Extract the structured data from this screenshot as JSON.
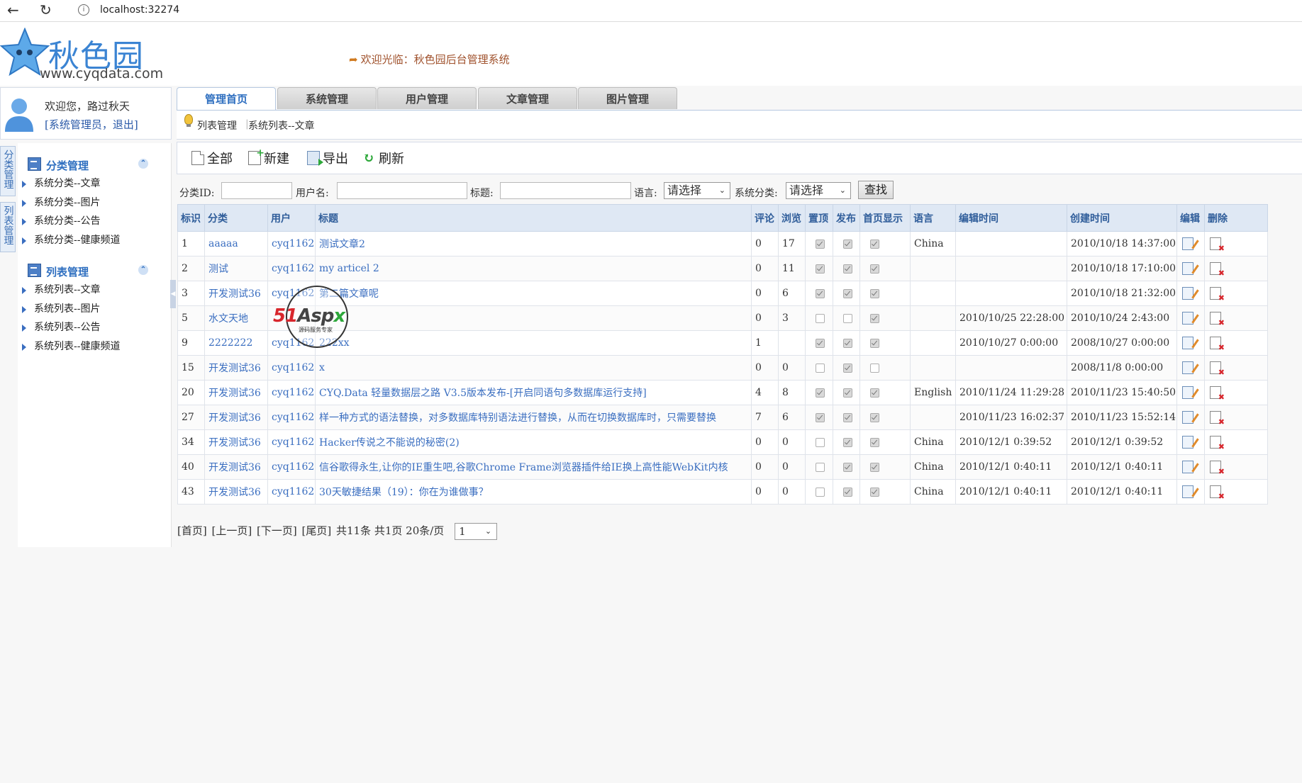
{
  "browser": {
    "url": "localhost:32274"
  },
  "header": {
    "logo_title": "秋色园",
    "logo_url": "www.cyqdata.com",
    "welcome_banner": "欢迎光临：秋色园后台管理系统"
  },
  "user": {
    "greeting": "欢迎您，路过秋天",
    "links": "[系统管理员，退出]"
  },
  "side_tabs": [
    "分类管理",
    "列表管理"
  ],
  "menu": {
    "group1": {
      "title": "分类管理",
      "items": [
        "系统分类--文章",
        "系统分类--图片",
        "系统分类--公告",
        "系统分类--健康频道"
      ]
    },
    "group2": {
      "title": "列表管理",
      "items": [
        "系统列表--文章",
        "系统列表--图片",
        "系统列表--公告",
        "系统列表--健康频道"
      ]
    }
  },
  "tabs": [
    "管理首页",
    "系统管理",
    "用户管理",
    "文章管理",
    "图片管理"
  ],
  "breadcrumb": {
    "first": "列表管理",
    "second": "系统列表--文章"
  },
  "toolbar": {
    "all": "全部",
    "new": "新建",
    "export": "导出",
    "refresh": "刷新"
  },
  "search": {
    "category_id_label": "分类ID:",
    "username_label": "用户名:",
    "title_label": "标题:",
    "language_label": "语言:",
    "language_value": "请选择",
    "category_label": "系统分类:",
    "category_value": "请选择",
    "button": "查找"
  },
  "table": {
    "headers": [
      "标识",
      "分类",
      "用户",
      "标题",
      "评论",
      "浏览",
      "置顶",
      "发布",
      "首页显示",
      "语言",
      "编辑时间",
      "创建时间",
      "编辑",
      "删除"
    ],
    "rows": [
      {
        "id": "1",
        "category": "aaaaa",
        "user": "cyq1162",
        "title": "测试文章2",
        "comments": "0",
        "views": "17",
        "top": true,
        "published": true,
        "homepage": true,
        "language": "China",
        "edited": "",
        "created": "2010/10/18 14:37:00"
      },
      {
        "id": "2",
        "category": "测试",
        "user": "cyq1162",
        "title": "my articel 2",
        "comments": "0",
        "views": "11",
        "top": true,
        "published": true,
        "homepage": true,
        "language": "",
        "edited": "",
        "created": "2010/10/18 17:10:00"
      },
      {
        "id": "3",
        "category": "开发测试36",
        "user": "cyq1162",
        "title": "第二篇文章呢",
        "comments": "0",
        "views": "6",
        "top": true,
        "published": true,
        "homepage": true,
        "language": "",
        "edited": "",
        "created": "2010/10/18 21:32:00"
      },
      {
        "id": "5",
        "category": "水文天地",
        "user": "",
        "title": "",
        "comments": "0",
        "views": "3",
        "top": false,
        "published": false,
        "homepage": true,
        "language": "",
        "edited": "2010/10/25 22:28:00",
        "created": "2010/10/24 2:43:00"
      },
      {
        "id": "9",
        "category": "2222222",
        "user": "cyq1162",
        "title": "222xx",
        "comments": "1",
        "views": "",
        "top": true,
        "published": true,
        "homepage": true,
        "language": "",
        "edited": "2010/10/27 0:00:00",
        "created": "2008/10/27 0:00:00"
      },
      {
        "id": "15",
        "category": "开发测试36",
        "user": "cyq1162",
        "title": "x",
        "comments": "0",
        "views": "0",
        "top": false,
        "published": true,
        "homepage": false,
        "language": "",
        "edited": "",
        "created": "2008/11/8 0:00:00"
      },
      {
        "id": "20",
        "category": "开发测试36",
        "user": "cyq1162",
        "title": "CYQ.Data 轻量数据层之路 V3.5版本发布-[开启同语句多数据库运行支持]",
        "comments": "4",
        "views": "8",
        "top": true,
        "published": true,
        "homepage": true,
        "language": "English",
        "edited": "2010/11/24 11:29:28",
        "created": "2010/11/23 15:40:50"
      },
      {
        "id": "27",
        "category": "开发测试36",
        "user": "cyq1162",
        "title": "样一种方式的语法替换，对多数据库特别语法进行替换，从而在切换数据库时，只需要替换",
        "comments": "7",
        "views": "6",
        "top": true,
        "published": true,
        "homepage": true,
        "language": "",
        "edited": "2010/11/23 16:02:37",
        "created": "2010/11/23 15:52:14"
      },
      {
        "id": "34",
        "category": "开发测试36",
        "user": "cyq1162",
        "title": "Hacker传说之不能说的秘密(2)",
        "comments": "0",
        "views": "0",
        "top": false,
        "published": true,
        "homepage": true,
        "language": "China",
        "edited": "2010/12/1 0:39:52",
        "created": "2010/12/1 0:39:52"
      },
      {
        "id": "40",
        "category": "开发测试36",
        "user": "cyq1162",
        "title": "信谷歌得永生,让你的IE重生吧,谷歌Chrome Frame浏览器插件给IE换上高性能WebKit内核",
        "comments": "0",
        "views": "0",
        "top": false,
        "published": true,
        "homepage": true,
        "language": "China",
        "edited": "2010/12/1 0:40:11",
        "created": "2010/12/1 0:40:11"
      },
      {
        "id": "43",
        "category": "开发测试36",
        "user": "cyq1162",
        "title": "30天敏捷结果（19）：你在为谁做事？",
        "comments": "0",
        "views": "0",
        "top": false,
        "published": true,
        "homepage": true,
        "language": "China",
        "edited": "2010/12/1 0:40:11",
        "created": "2010/12/1 0:40:11"
      }
    ]
  },
  "pager": {
    "first": "[首页]",
    "prev": "[上一页]",
    "next": "[下一页]",
    "last": "[尾页]",
    "summary": "共11条 共1页 20条/页",
    "page_value": "1"
  },
  "watermark": {
    "brand_red": "51",
    "brand_mid": "Asp",
    "brand_green": "x",
    "sub": "源码服务专家"
  }
}
